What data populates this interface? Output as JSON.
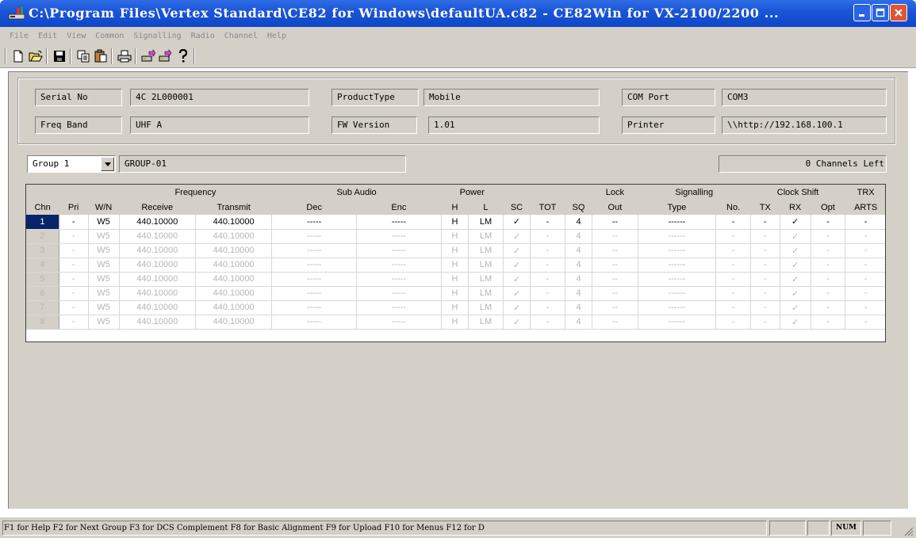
{
  "window": {
    "title": "C:\\Program Files\\Vertex Standard\\CE82 for Windows\\defaultUA.c82 - CE82Win for VX-2100/2200 ..."
  },
  "menu": [
    "File",
    "Edit",
    "View",
    "Common",
    "Signalling",
    "Radio",
    "Channel",
    "Help"
  ],
  "toolbar": [
    "new-icon",
    "open-icon",
    "save-icon",
    "copy-icon",
    "paste-icon",
    "print-icon",
    "read-radio-icon",
    "write-radio-icon",
    "help-icon"
  ],
  "info": {
    "serial_label": "Serial No",
    "serial_value": "4C 2L000001",
    "product_label": "ProductType",
    "product_value": "Mobile",
    "com_label": "COM Port",
    "com_value": "COM3",
    "freq_label": "Freq Band",
    "freq_value": "UHF A",
    "fw_label": "FW Version",
    "fw_value": "1.01",
    "printer_label": "Printer",
    "printer_value": "\\\\http://192.168.100.1"
  },
  "group": {
    "selected": "Group 1",
    "name": "GROUP-01",
    "channels_left": "0 Channels Left"
  },
  "grid": {
    "group_headers": {
      "frequency": "Frequency",
      "sub_audio": "Sub Audio",
      "power": "Power",
      "lock": "Lock",
      "signalling": "Signalling",
      "clock_shift": "Clock Shift",
      "trx": "TRX"
    },
    "columns": [
      "Chn",
      "Pri",
      "W/N",
      "Receive",
      "Transmit",
      "Dec",
      "Enc",
      "H",
      "L",
      "SC",
      "TOT",
      "SQ",
      "Out",
      "Type",
      "No.",
      "TX",
      "RX",
      "Opt",
      "ARTS"
    ],
    "rows": [
      [
        "1",
        "-",
        "W5",
        "440.10000",
        "440.10000",
        "-----",
        "-----",
        "H",
        "LM",
        "✓",
        "-",
        "4",
        "--",
        "------",
        "-",
        "-",
        "✓",
        "-",
        "-"
      ],
      [
        "2",
        "-",
        "W5",
        "440.10000",
        "440.10000",
        "-----",
        "-----",
        "H",
        "LM",
        "✓",
        "-",
        "4",
        "--",
        "------",
        "-",
        "-",
        "✓",
        "-",
        "-"
      ],
      [
        "3",
        "-",
        "W5",
        "440.10000",
        "440.10000",
        "-----",
        "-----",
        "H",
        "LM",
        "✓",
        "-",
        "4",
        "--",
        "------",
        "-",
        "-",
        "✓",
        "-",
        "-"
      ],
      [
        "4",
        "-",
        "W5",
        "440.10000",
        "440.10000",
        "-----",
        "-----",
        "H",
        "LM",
        "✓",
        "-",
        "4",
        "--",
        "------",
        "-",
        "-",
        "✓",
        "-",
        "-"
      ],
      [
        "5",
        "-",
        "W5",
        "440.10000",
        "440.10000",
        "-----",
        "-----",
        "H",
        "LM",
        "✓",
        "-",
        "4",
        "--",
        "------",
        "-",
        "-",
        "✓",
        "-",
        "-"
      ],
      [
        "6",
        "-",
        "W5",
        "440.10000",
        "440.10000",
        "-----",
        "-----",
        "H",
        "LM",
        "✓",
        "-",
        "4",
        "--",
        "------",
        "-",
        "-",
        "✓",
        "-",
        "-"
      ],
      [
        "7",
        "-",
        "W5",
        "440.10000",
        "440.10000",
        "-----",
        "-----",
        "H",
        "LM",
        "✓",
        "-",
        "4",
        "--",
        "------",
        "-",
        "-",
        "✓",
        "-",
        "-"
      ],
      [
        "8",
        "-",
        "W5",
        "440.10000",
        "440.10000",
        "-----",
        "-----",
        "H",
        "LM",
        "✓",
        "-",
        "4",
        "--",
        "------",
        "-",
        "-",
        "✓",
        "-",
        "-"
      ]
    ]
  },
  "status": {
    "text": "F1 for Help  F2 for Next Group  F3 for DCS Complement  F8 for Basic Alignment  F9 for Upload  F10 for Menus  F12 for D",
    "num": "NUM"
  },
  "colors": {
    "title_bar": "#1c56d8",
    "face": "#d4d0c8",
    "workspace": "#808080",
    "selection": "#0a246a"
  }
}
